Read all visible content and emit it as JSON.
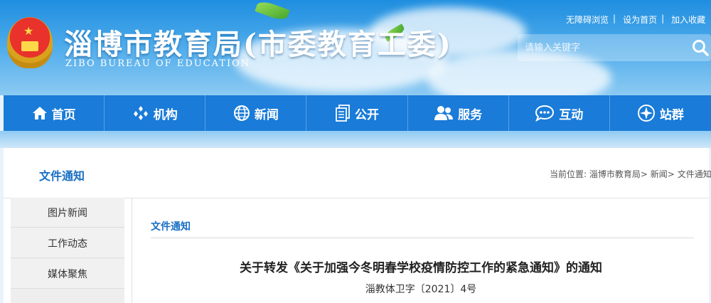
{
  "header": {
    "title": "淄博市教育局(市委教育工委)",
    "subtitle": "ZIBO BUREAU OF EDUCATION",
    "top_links": [
      "无障碍浏览",
      "设为首页",
      "加入收藏"
    ],
    "search_placeholder": "请输入关键字"
  },
  "nav": {
    "items": [
      {
        "label": "首页",
        "icon": "home-icon"
      },
      {
        "label": "机构",
        "icon": "org-icon"
      },
      {
        "label": "新闻",
        "icon": "globe-icon"
      },
      {
        "label": "公开",
        "icon": "document-icon"
      },
      {
        "label": "服务",
        "icon": "users-icon"
      },
      {
        "label": "互动",
        "icon": "chat-icon"
      },
      {
        "label": "站群",
        "icon": "compass-icon"
      }
    ]
  },
  "section": {
    "title": "文件通知"
  },
  "breadcrumb": {
    "prefix": "当前位置:",
    "items": [
      "淄博市教育局",
      "新闻",
      "文件通知"
    ],
    "separator": ">"
  },
  "sidebar": {
    "items": [
      "图片新闻",
      "工作动态",
      "媒体聚焦"
    ]
  },
  "main": {
    "label": "文件通知",
    "article_title": "关于转发《关于加强今冬明春学校疫情防控工作的紧急通知》的通知",
    "doc_number": "淄教体卫字〔2021〕4号"
  },
  "colors": {
    "nav_bg": "#1a7bd8",
    "accent": "#1a6fc4",
    "header_bg": "#2b95e4"
  }
}
